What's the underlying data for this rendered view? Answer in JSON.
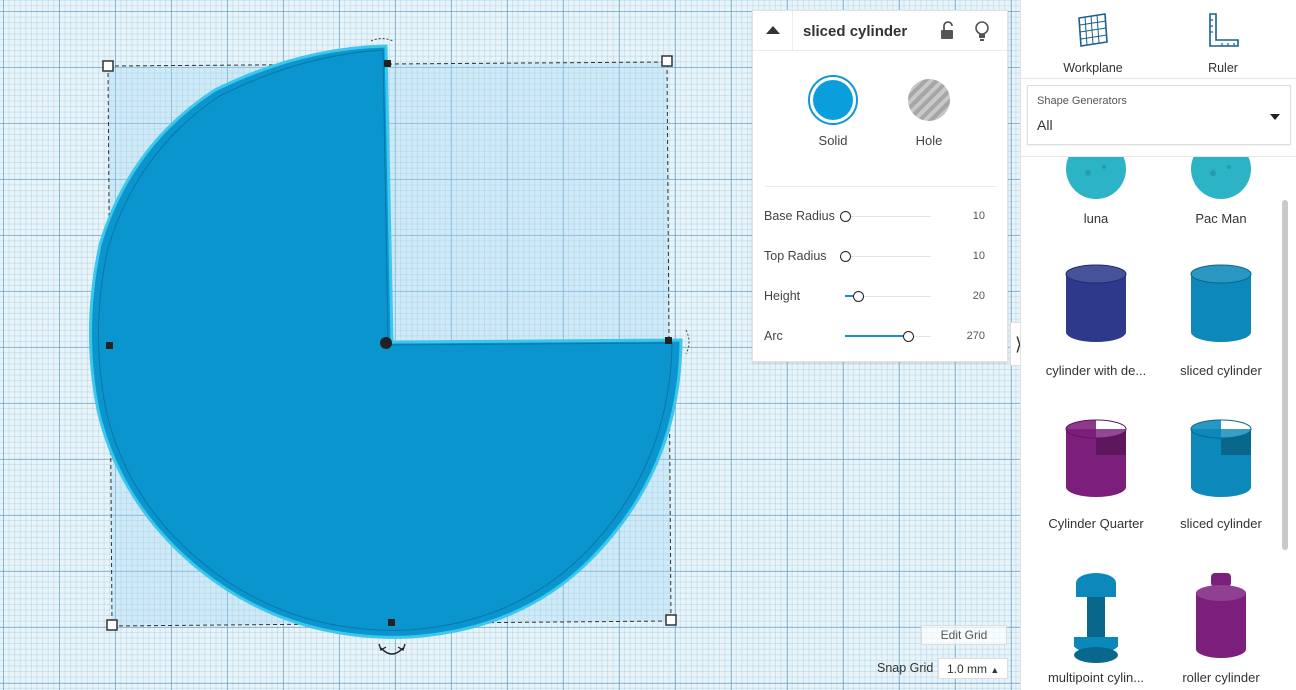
{
  "inspector": {
    "shape_name": "sliced cylinder",
    "solid_label": "Solid",
    "hole_label": "Hole",
    "properties": [
      {
        "label": "Base Radius",
        "value": "10",
        "level": 0.0
      },
      {
        "label": "Top Radius",
        "value": "10",
        "level": 0.0
      },
      {
        "label": "Height",
        "value": "20",
        "level": 0.15
      },
      {
        "label": "Arc",
        "value": "270",
        "level": 0.73
      }
    ]
  },
  "workplane": {
    "edit_grid_label": "Edit Grid",
    "snap_grid_label": "Snap Grid",
    "snap_grid_value": "1.0 mm"
  },
  "right_panel": {
    "workplane_label": "Workplane",
    "ruler_label": "Ruler",
    "generator_caption": "Shape Generators",
    "generator_value": "All",
    "shapes": [
      {
        "label": "luna",
        "color": "#2cb3c5",
        "icon": "sphere"
      },
      {
        "label": "Pac Man",
        "color": "#2cb3c5",
        "icon": "sphere"
      },
      {
        "label": "cylinder with de...",
        "color": "#2d3a8c",
        "icon": "cylinder"
      },
      {
        "label": "sliced cylinder",
        "color": "#0c89ba",
        "icon": "cylinder"
      },
      {
        "label": "Cylinder Quarter",
        "color": "#7c1e7c",
        "icon": "sliced-cylinder"
      },
      {
        "label": "sliced cylinder",
        "color": "#0c89ba",
        "icon": "sliced-cylinder"
      },
      {
        "label": "multipoint cylin...",
        "color": "#0c89ba",
        "icon": "spool"
      },
      {
        "label": "roller cylinder",
        "color": "#7c1e7c",
        "icon": "roller"
      }
    ]
  },
  "colors": {
    "accent": "#1496d6",
    "shape_fill": "#0a95cf",
    "selection_outline": "#3cc8ec"
  }
}
